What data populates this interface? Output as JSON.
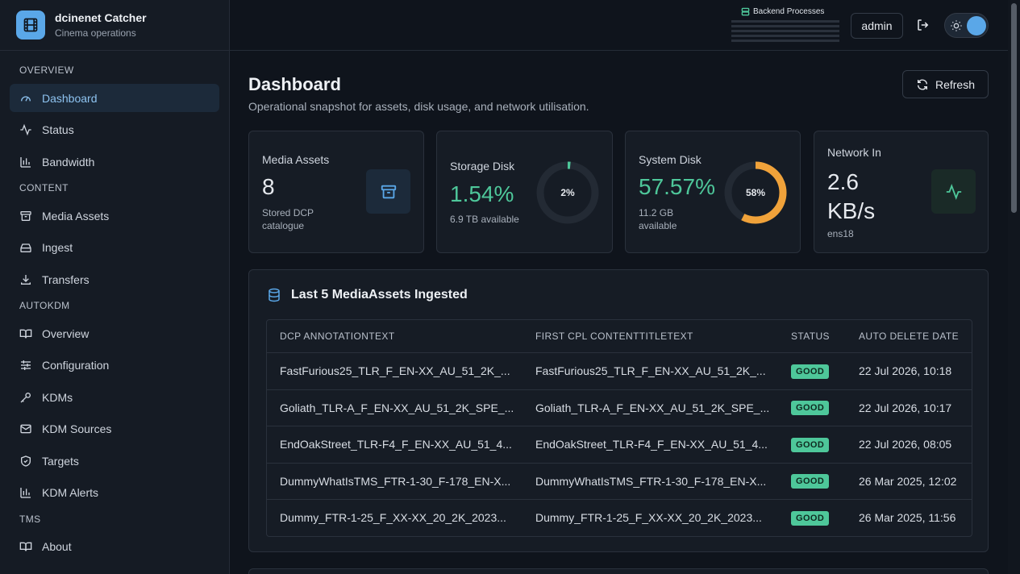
{
  "brand": {
    "title": "dcinenet Catcher",
    "subtitle": "Cinema operations"
  },
  "nav": {
    "sections": [
      {
        "label": "OVERVIEW",
        "items": [
          {
            "label": "Dashboard",
            "icon": "gauge-icon",
            "active": true
          },
          {
            "label": "Status",
            "icon": "activity-icon"
          },
          {
            "label": "Bandwidth",
            "icon": "bar-chart-icon"
          }
        ]
      },
      {
        "label": "CONTENT",
        "items": [
          {
            "label": "Media Assets",
            "icon": "archive-icon"
          },
          {
            "label": "Ingest",
            "icon": "hard-drive-icon"
          },
          {
            "label": "Transfers",
            "icon": "download-icon"
          }
        ]
      },
      {
        "label": "AUTOKDM",
        "items": [
          {
            "label": "Overview",
            "icon": "book-open-icon"
          },
          {
            "label": "Configuration",
            "icon": "sliders-icon"
          },
          {
            "label": "KDMs",
            "icon": "key-icon"
          },
          {
            "label": "KDM Sources",
            "icon": "mail-icon"
          },
          {
            "label": "Targets",
            "icon": "shield-icon"
          },
          {
            "label": "KDM Alerts",
            "icon": "bar-chart-icon"
          }
        ]
      },
      {
        "label": "TMS",
        "items": [
          {
            "label": "About",
            "icon": "book-open-icon"
          }
        ]
      }
    ]
  },
  "topbar": {
    "backend_processes": "Backend Processes",
    "user": "admin"
  },
  "page": {
    "title": "Dashboard",
    "subtitle": "Operational snapshot for assets, disk usage, and network utilisation.",
    "refresh_label": "Refresh"
  },
  "cards": {
    "media": {
      "label": "Media Assets",
      "value": "8",
      "sub": "Stored DCP catalogue"
    },
    "storage": {
      "label": "Storage Disk",
      "value": "1.54%",
      "sub": "6.9 TB available",
      "ring_label": "2%",
      "percent": 1.54
    },
    "system": {
      "label": "System Disk",
      "value": "57.57%",
      "sub": "11.2 GB available",
      "ring_label": "58%",
      "percent": 57.57
    },
    "network": {
      "label": "Network In",
      "value": "2.6 KB/s",
      "sub": "ens18"
    }
  },
  "colors": {
    "accent": "#5aa7e8",
    "good": "#4ec79a",
    "warn": "#f0a23a"
  },
  "table": {
    "title": "Last 5 MediaAssets Ingested",
    "headers": [
      "DCP ANNOTATIONTEXT",
      "FIRST CPL CONTENTTITLETEXT",
      "STATUS",
      "AUTO DELETE DATE"
    ],
    "rows": [
      [
        "FastFurious25_TLR_F_EN-XX_AU_51_2K_...",
        "FastFurious25_TLR_F_EN-XX_AU_51_2K_...",
        "GOOD",
        "22 Jul 2026, 10:18"
      ],
      [
        "Goliath_TLR-A_F_EN-XX_AU_51_2K_SPE_...",
        "Goliath_TLR-A_F_EN-XX_AU_51_2K_SPE_...",
        "GOOD",
        "22 Jul 2026, 10:17"
      ],
      [
        "EndOakStreet_TLR-F4_F_EN-XX_AU_51_4...",
        "EndOakStreet_TLR-F4_F_EN-XX_AU_51_4...",
        "GOOD",
        "22 Jul 2026, 08:05"
      ],
      [
        "DummyWhatIsTMS_FTR-1-30_F-178_EN-X...",
        "DummyWhatIsTMS_FTR-1-30_F-178_EN-X...",
        "GOOD",
        "26 Mar 2025, 12:02"
      ],
      [
        "Dummy_FTR-1-25_F_XX-XX_20_2K_2023...",
        "Dummy_FTR-1-25_F_XX-XX_20_2K_2023...",
        "GOOD",
        "26 Mar 2025, 11:56"
      ]
    ]
  }
}
